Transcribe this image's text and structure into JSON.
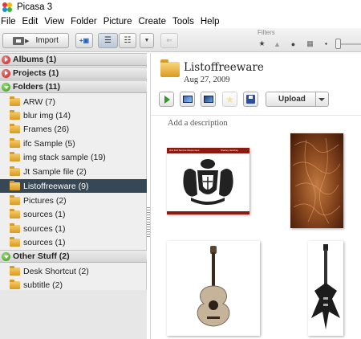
{
  "window": {
    "title": "Picasa 3",
    "colors": {
      "selected_bg": "#364856",
      "section_header_bg": "#dcdcdc",
      "pane_bg": "#efefef",
      "folder_icon": "#e6b348"
    }
  },
  "menu": [
    "File",
    "Edit",
    "View",
    "Folder",
    "Picture",
    "Create",
    "Tools",
    "Help"
  ],
  "toolbar": {
    "import_label": "Import",
    "filters_label": "Filters",
    "icons": [
      "import-icon",
      "add-to-library-icon",
      "list-view-icon",
      "tree-view-icon",
      "dropdown-icon",
      "people-back-icon",
      "star-filter-icon",
      "upload-filter-icon",
      "face-filter-icon",
      "movie-filter-icon",
      "geotag-filter-icon"
    ]
  },
  "sidebar": {
    "sections": [
      {
        "label": "Albums (1)",
        "state": "collapsed"
      },
      {
        "label": "Projects (1)",
        "state": "collapsed"
      },
      {
        "label": "Folders (11)",
        "state": "expanded"
      },
      {
        "label": "Other Stuff (2)",
        "state": "expanded"
      }
    ],
    "folders": [
      {
        "label": "ARW (7)"
      },
      {
        "label": "blur img (14)"
      },
      {
        "label": "Frames (26)"
      },
      {
        "label": "ifc Sample (5)"
      },
      {
        "label": "img stack sample (19)"
      },
      {
        "label": "Jt Sample file (2)"
      },
      {
        "label": "Listoffreeware (9)",
        "selected": true
      },
      {
        "label": "Pictures (2)"
      },
      {
        "label": "sources (1)"
      },
      {
        "label": "sources (1)"
      },
      {
        "label": "sources (1)"
      }
    ],
    "other_stuff": [
      {
        "label": "Desk Shortcut (2)"
      },
      {
        "label": "subtitle (2)"
      }
    ]
  },
  "album": {
    "title": "Listoffreeware",
    "date": "Aug 27, 2009",
    "add_description": "Add a description",
    "upload_label": "Upload",
    "tool_icons": [
      "play-slideshow-icon",
      "make-collage-icon",
      "make-movie-icon",
      "star-icon",
      "save-icon"
    ]
  },
  "thumbnails": [
    {
      "name": "coat-of-arms-certificate",
      "caption_top_left": "2nd Full Service Responses",
      "caption_top_right": "Stanley Hershey"
    },
    {
      "name": "copper-texture"
    },
    {
      "name": "acoustic-guitar"
    },
    {
      "name": "electric-guitar"
    }
  ]
}
